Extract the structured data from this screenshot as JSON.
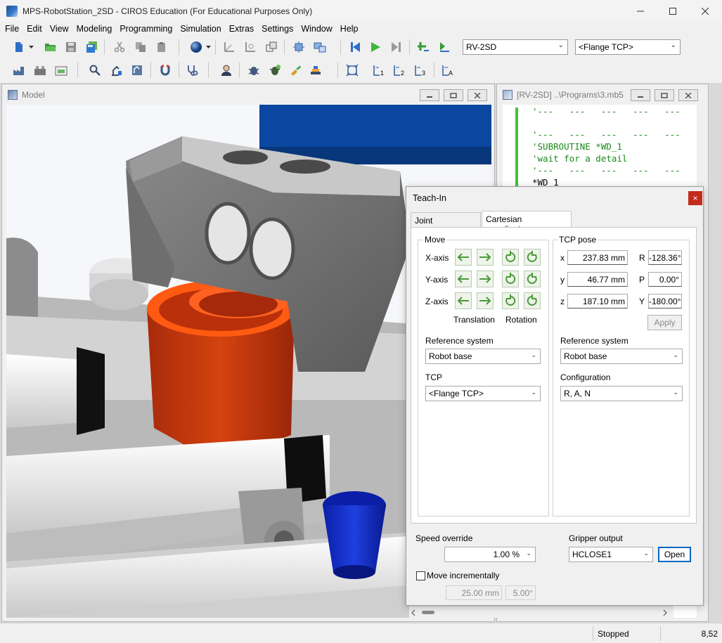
{
  "window": {
    "title": "MPS-RobotStation_2SD - CIROS Education (For Educational Purposes Only)"
  },
  "menu": [
    "File",
    "Edit",
    "View",
    "Modeling",
    "Programming",
    "Simulation",
    "Extras",
    "Settings",
    "Window",
    "Help"
  ],
  "toolbar": {
    "robot_select": "RV-2SD",
    "tcp_select": "<Flange TCP>"
  },
  "model_window": {
    "title": "Model"
  },
  "code_window": {
    "title": "[RV-2SD] ..\\Programs\\3.mb5",
    "lines": [
      {
        "text": "'---   ---   ---   ---   ---",
        "kind": "comment"
      },
      {
        "text": "",
        "kind": "plain"
      },
      {
        "text": "'---   ---   ---   ---   ---",
        "kind": "comment"
      },
      {
        "text": "'SUBROUTINE *WD_1",
        "kind": "comment"
      },
      {
        "text": "'wait for a detail",
        "kind": "comment"
      },
      {
        "text": "'---   ---   ---   ---   ---",
        "kind": "comment"
      },
      {
        "text": "*WD_1",
        "kind": "plain"
      }
    ]
  },
  "teach_in": {
    "title": "Teach-In",
    "close_icon": "×",
    "tabs": [
      "Joint coordinates",
      "Cartesian coordinates"
    ],
    "active_tab": 1,
    "move": {
      "label": "Move",
      "axes": [
        "X-axis",
        "Y-axis",
        "Z-axis"
      ],
      "translation_label": "Translation",
      "rotation_label": "Rotation",
      "reference_label": "Reference system",
      "reference_value": "Robot base",
      "tcp_label": "TCP",
      "tcp_value": "<Flange TCP>"
    },
    "tcp_pose": {
      "label": "TCP pose",
      "x_label": "x",
      "x_value": "237.83 mm",
      "y_label": "y",
      "y_value": "46.77 mm",
      "z_label": "z",
      "z_value": "187.10 mm",
      "r_label": "R",
      "r_value": "-128.36°",
      "p_label": "P",
      "p_value": "0.00°",
      "yaw_label": "Y",
      "yaw_value": "-180.00°",
      "apply_label": "Apply",
      "reference_label": "Reference system",
      "reference_value": "Robot base",
      "config_label": "Configuration",
      "config_value": "R, A, N"
    },
    "speed_label": "Speed override",
    "speed_value": "1.00 %",
    "gripper_label": "Gripper output",
    "gripper_value": "HCLOSE1",
    "open_label": "Open",
    "move_incr_label": "Move incrementally",
    "incr_mm": "25.00 mm",
    "incr_deg": "5.00°"
  },
  "status": {
    "state": "Stopped",
    "coords": "8,52"
  }
}
